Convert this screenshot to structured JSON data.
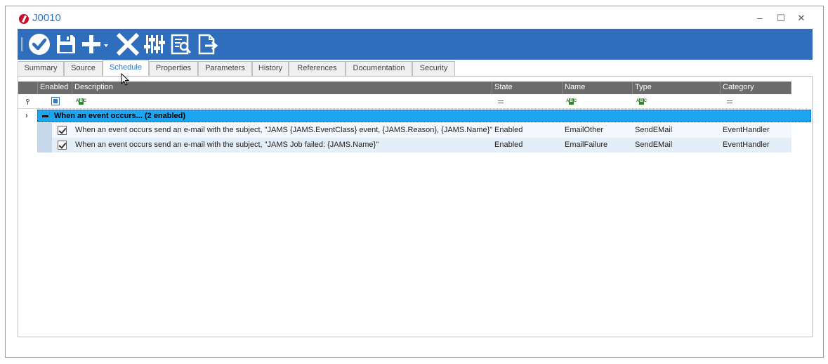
{
  "window": {
    "title": "J0010",
    "minimize_glyph": "‒",
    "maximize_glyph": "☐",
    "close_glyph": "✕"
  },
  "toolbar": {
    "buttons": [
      {
        "name": "ok-check-icon"
      },
      {
        "name": "save-icon"
      },
      {
        "name": "add-icon"
      },
      {
        "name": "delete-icon"
      },
      {
        "name": "settings-sliders-icon"
      },
      {
        "name": "preview-icon"
      },
      {
        "name": "export-icon"
      }
    ]
  },
  "tabs": [
    {
      "label": "Summary"
    },
    {
      "label": "Source"
    },
    {
      "label": "Schedule",
      "active": true
    },
    {
      "label": "Properties"
    },
    {
      "label": "Parameters"
    },
    {
      "label": "History"
    },
    {
      "label": "References"
    },
    {
      "label": "Documentation"
    },
    {
      "label": "Security"
    }
  ],
  "grid": {
    "columns": {
      "enabled": "Enabled",
      "description": "Description",
      "state": "State",
      "name": "Name",
      "type": "Type",
      "category": "Category"
    },
    "group": {
      "label": "When an event occurs... (2 enabled)"
    },
    "rows": [
      {
        "enabled": true,
        "description": "When an event occurs send an e-mail with the subject, \"JAMS {JAMS.EventClass} event,  {JAMS.Reason}, {JAMS.Name}\"",
        "state": "Enabled",
        "name": "EmailOther",
        "type": "SendEMail",
        "category": "EventHandler"
      },
      {
        "enabled": true,
        "description": "When an event occurs send an e-mail with the subject, \"JAMS Job failed: {JAMS.Name}\"",
        "state": "Enabled",
        "name": "EmailFailure",
        "type": "SendEMail",
        "category": "EventHandler"
      }
    ]
  },
  "colors": {
    "toolbar": "#2f6dbd",
    "header": "#6b6b6b",
    "group_band": "#1ea5f0",
    "accent": "#2e75c8"
  }
}
